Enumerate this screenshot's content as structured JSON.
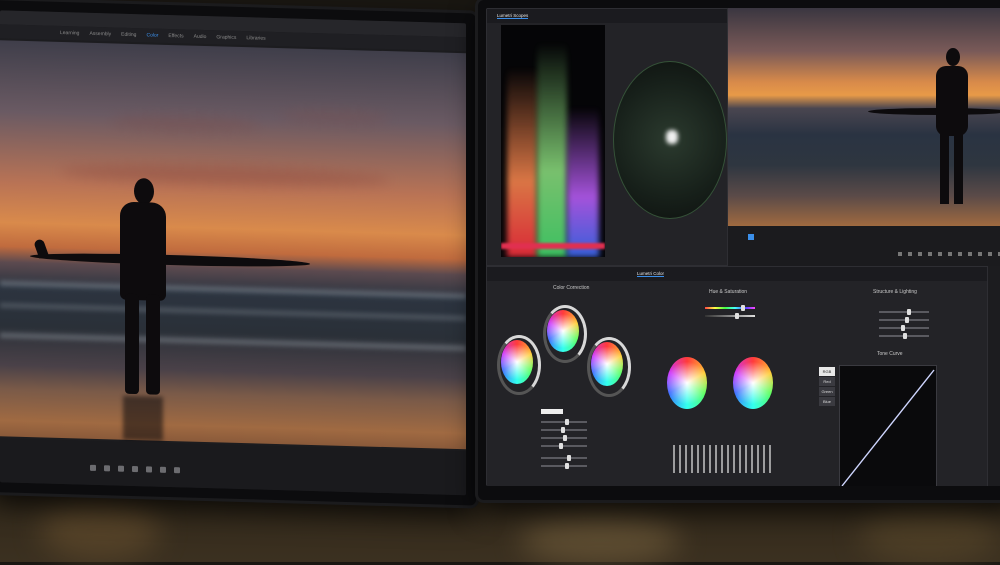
{
  "left_screen": {
    "workspace_tabs": [
      "Learning",
      "Assembly",
      "Editing",
      "Color",
      "Effects",
      "Audio",
      "Graphics",
      "Libraries"
    ],
    "active_tab": "Color"
  },
  "right_screen": {
    "top_tabs": [
      "Lumetri Scopes"
    ],
    "panel_tabs": [
      "Lumetri Color"
    ],
    "color_correction": {
      "title": "Color Correction"
    },
    "hue_saturation": {
      "title": "Hue & Saturation"
    },
    "structure_lighting": {
      "title": "Structure & Lighting"
    },
    "tone_curve": {
      "title": "Tone Curve",
      "channels": [
        "RGB",
        "Red",
        "Green",
        "Blue"
      ],
      "active_channel": "RGB"
    }
  },
  "colors": {
    "accent": "#3b8fea",
    "sky_orange": "#d98a4b",
    "water": "#2c3440"
  }
}
